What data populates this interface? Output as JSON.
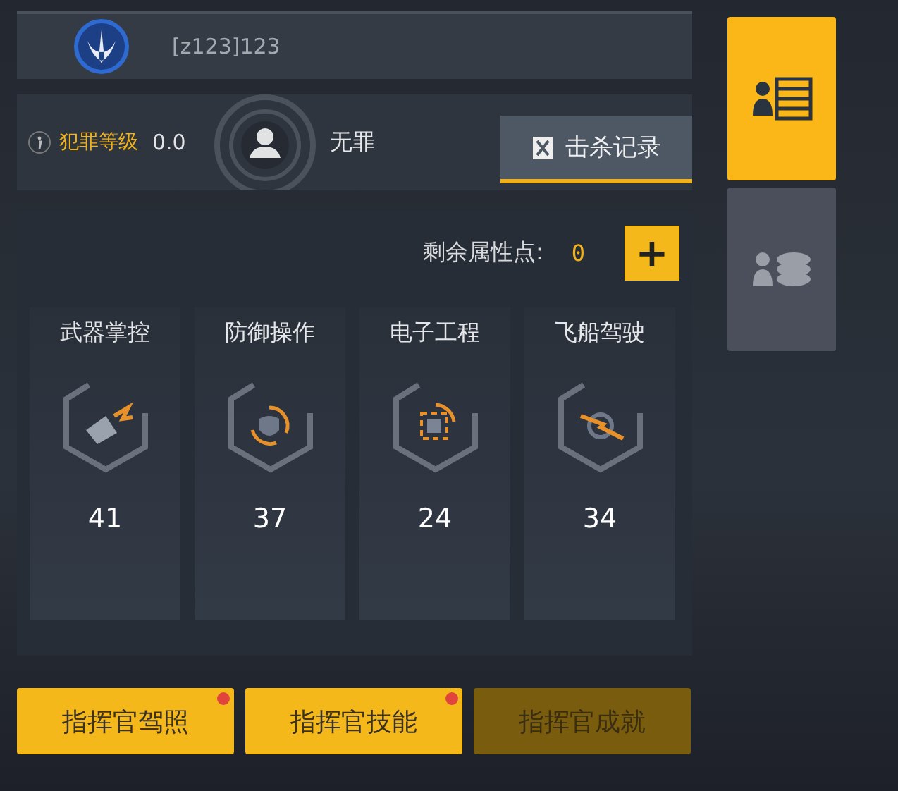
{
  "player": {
    "name": "[z123]123"
  },
  "crime": {
    "label": "犯罪等级",
    "value": "0.0",
    "status": "无罪",
    "kill_button": "击杀记录"
  },
  "attributes": {
    "remaining_label": "剩余属性点:",
    "remaining_value": "0",
    "add_button": "+",
    "skills": [
      {
        "name": "武器掌控",
        "value": "41"
      },
      {
        "name": "防御操作",
        "value": "37"
      },
      {
        "name": "电子工程",
        "value": "24"
      },
      {
        "name": "飞船驾驶",
        "value": "34"
      }
    ]
  },
  "buttons": [
    {
      "label": "指挥官驾照",
      "badge": true,
      "disabled": false
    },
    {
      "label": "指挥官技能",
      "badge": true,
      "disabled": false
    },
    {
      "label": "指挥官成就",
      "badge": false,
      "disabled": true
    }
  ],
  "side_tabs": [
    {
      "selected": true
    },
    {
      "selected": false
    }
  ]
}
